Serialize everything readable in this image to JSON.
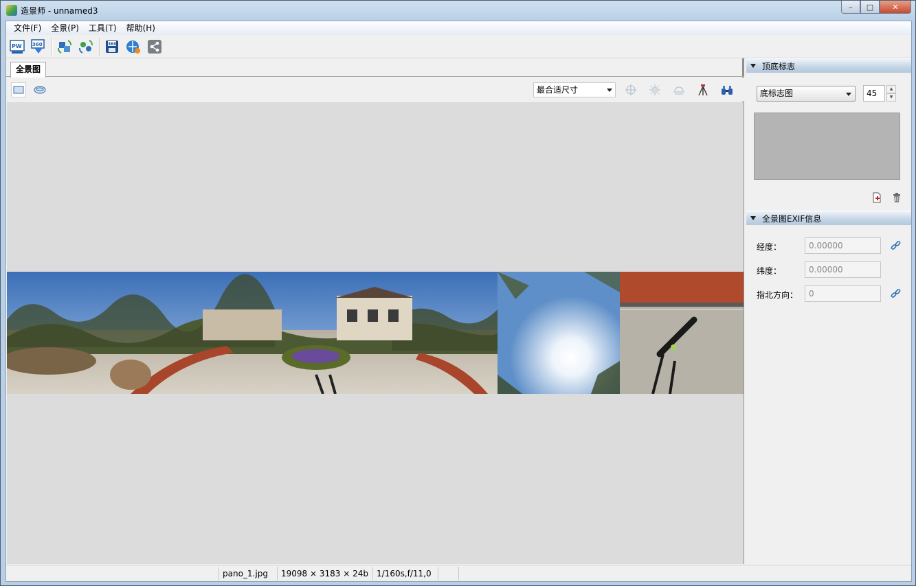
{
  "window": {
    "title": "造景师 - unnamed3",
    "controls": {
      "minimize": "–",
      "maximize": "□",
      "close": "✕"
    }
  },
  "menu": [
    "文件(F)",
    "全景(P)",
    "工具(T)",
    "帮助(H)"
  ],
  "toolbar": {
    "buttons": [
      "pw-export-icon",
      "360-export-icon",
      "refresh-blue-icon",
      "refresh-green-icon",
      "save-360-icon",
      "publish-web-icon",
      "share-icon"
    ]
  },
  "main": {
    "tab": "全景图",
    "fit_select": "最合适尺寸",
    "view_icons": [
      "flat-view-icon",
      "sphere-view-icon"
    ],
    "tool_icons": [
      "crosshair-icon",
      "brightness-icon",
      "horizon-icon",
      "tripod-icon",
      "binoculars-icon"
    ]
  },
  "panel": {
    "section1_title": "顶底标志",
    "logo_select": "底标志图",
    "logo_size": "45",
    "section2_title": "全景图EXIF信息",
    "longitude_label": "经度：",
    "longitude_value": "0.00000",
    "latitude_label": "纬度：",
    "latitude_value": "0.00000",
    "north_label": "指北方向：",
    "north_value": "0"
  },
  "status": {
    "filename": "pano_1.jpg",
    "dimensions": "19098 × 3183 × 24b",
    "exposure": "1/160s,f/11,0"
  },
  "colors": {
    "accent": "#3a7bd5",
    "canvas_bg": "#dcdcdc",
    "panel_header": "#c6d6e6"
  }
}
